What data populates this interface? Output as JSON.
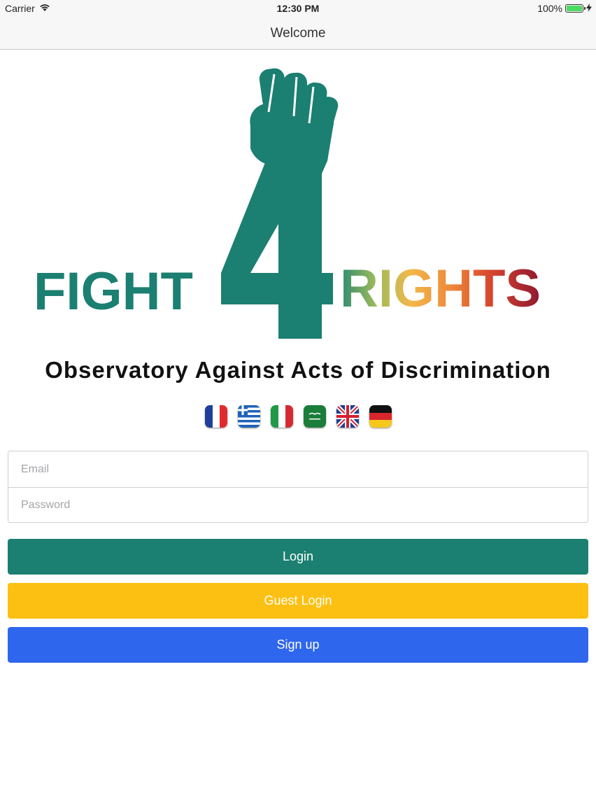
{
  "status_bar": {
    "carrier": "Carrier",
    "time": "12:30 PM",
    "battery": "100%",
    "wifi_icon": "wifi-icon",
    "battery_icon": "battery-icon",
    "charging_icon": "bolt-icon"
  },
  "nav": {
    "title": "Welcome"
  },
  "logo": {
    "left_text": "FIGHT",
    "number": "4",
    "right_text": "RIGHTS",
    "icon": "raised-fist-icon",
    "colors": {
      "brand_green": "#1b7f71",
      "orange": "#f5a623",
      "red": "#a51d2d"
    }
  },
  "tagline": "Observatory Against Acts of Discrimination",
  "languages": [
    "fr",
    "gr",
    "it",
    "sa",
    "gb",
    "de"
  ],
  "form": {
    "email_placeholder": "Email",
    "password_placeholder": "Password"
  },
  "buttons": {
    "login": "Login",
    "guest_login": "Guest Login",
    "sign_up": "Sign up"
  },
  "colors": {
    "login": "#1b7f71",
    "guest": "#fcc012",
    "signup": "#2f66ee"
  }
}
